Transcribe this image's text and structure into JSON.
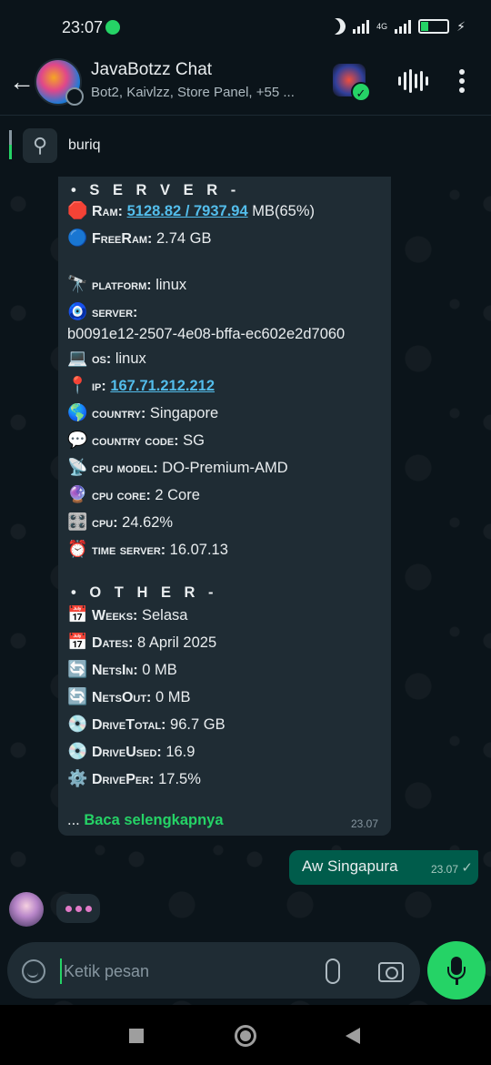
{
  "status_bar": {
    "time": "23:07",
    "network": "4G",
    "battery": "27",
    "icons": [
      "whatsapp-icon",
      "moon-icon",
      "signal-icon",
      "battery-icon",
      "bolt-icon"
    ]
  },
  "header": {
    "title": "JavaBotzz Chat",
    "subtitle": "Bot2, Kaivlzz, Store Panel, +55 ...",
    "icons": [
      "back-arrow-icon",
      "group-avatar",
      "bot-app-icon",
      "voice-wave-icon",
      "more-vert-icon"
    ]
  },
  "pinned": {
    "text": "buriq",
    "icon": "pin-icon"
  },
  "incoming_message": {
    "server_header": "• S E R V E R -",
    "lines": [
      {
        "emoji": "🛑",
        "label": "Ram:",
        "value_link": "5128.82 / 7937.94",
        "value": " MB(65%)"
      },
      {
        "emoji": "🔵",
        "label": "FreeRam:",
        "value": " 2.74 GB"
      },
      {
        "emoji": "🔭",
        "label": "platform:",
        "value": " linux"
      },
      {
        "emoji": "🧿",
        "label": "server:",
        "value": ""
      },
      {
        "emoji": "",
        "label": "",
        "value": "b0091e12-2507-4e08-bffa-ec602e2d7060"
      },
      {
        "emoji": "💻",
        "label": "os:",
        "value": " linux"
      },
      {
        "emoji": "📍",
        "label": "ip:",
        "value_link": "167.71.212.212",
        "value": ""
      },
      {
        "emoji": "🌎",
        "label": "country:",
        "value": " Singapore"
      },
      {
        "emoji": "💬",
        "label": "country code:",
        "value": " SG"
      },
      {
        "emoji": "📡",
        "label": "cpu model:",
        "value": " DO-Premium-AMD"
      },
      {
        "emoji": "🔮",
        "label": "cpu core:",
        "value": " 2 Core"
      },
      {
        "emoji": "🎛️",
        "label": "cpu:",
        "value": " 24.62%"
      },
      {
        "emoji": "⏰",
        "label": "time server:",
        "value": " 16.07.13"
      }
    ],
    "other_header": "• O T H E R -",
    "other_lines": [
      {
        "emoji": "📅",
        "label": "Weeks:",
        "value": " Selasa"
      },
      {
        "emoji": "📅",
        "label": "Dates:",
        "value": " 8 April 2025"
      },
      {
        "emoji": "🔄",
        "label": "NetsIn:",
        "value": " 0 MB"
      },
      {
        "emoji": "🔄",
        "label": "NetsOut:",
        "value": " 0 MB"
      },
      {
        "emoji": "💿",
        "label": "DriveTotal:",
        "value": " 96.7 GB"
      },
      {
        "emoji": "💿",
        "label": "DriveUsed:",
        "value": " 16.9"
      },
      {
        "emoji": "⚙️",
        "label": "DrivePer:",
        "value": " 17.5%"
      }
    ],
    "read_more_prefix": "... ",
    "read_more": "Baca selengkapnya",
    "time": "23.07"
  },
  "outgoing_message": {
    "text": "Aw Singapura",
    "time": "23.07",
    "tick": "✓"
  },
  "composer": {
    "placeholder": "Ketik pesan"
  },
  "colors": {
    "accent": "#25d366",
    "bubble_out": "#005c4b",
    "bubble_in": "#1f2c34",
    "link": "#53bdeb",
    "background": "#0b141a"
  }
}
